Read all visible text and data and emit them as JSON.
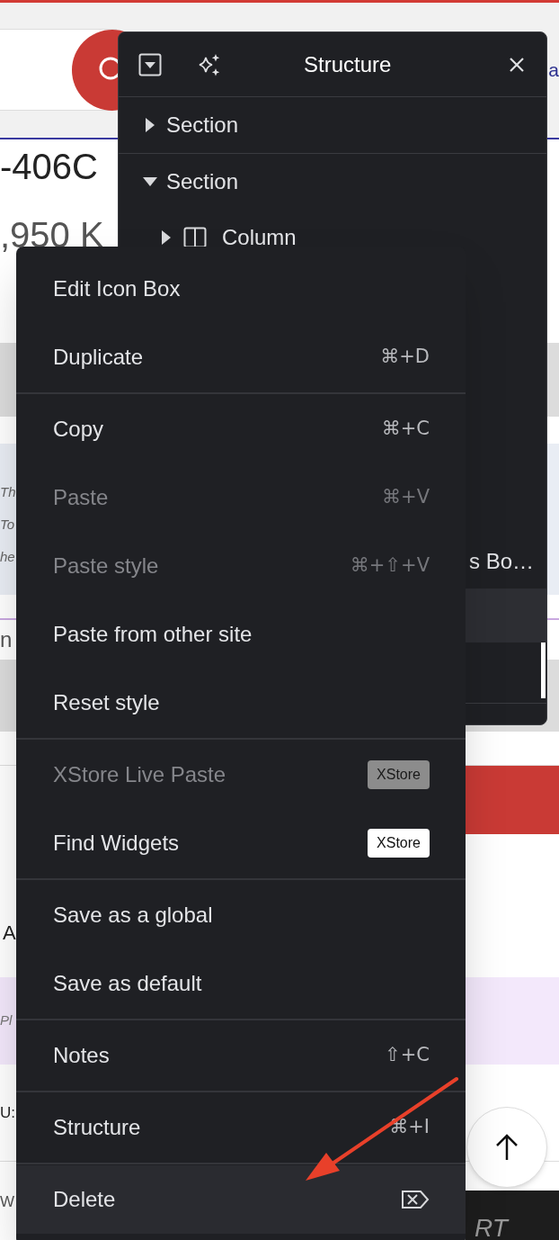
{
  "page_background": {
    "header_link": "a",
    "product_code": "-406C",
    "price": ",950 K",
    "notice_lines": [
      "Th",
      "To",
      "he"
    ],
    "tab_fragment": "n",
    "label_fragment": "A",
    "note_fragment": "Pl",
    "field_fragment": "U:",
    "total_fragment": "W",
    "button_fragment": "RT"
  },
  "structure_panel": {
    "title": "Structure",
    "tree": [
      {
        "kind": "section",
        "label": "Section",
        "expanded": false
      },
      {
        "kind": "section",
        "label": "Section",
        "expanded": true,
        "children": [
          {
            "kind": "column",
            "label": "Column",
            "expanded": false
          }
        ]
      }
    ],
    "lower_rows": [
      {
        "label": "s Bo…"
      }
    ]
  },
  "context_menu": {
    "groups": [
      [
        {
          "label": "Edit Icon Box",
          "disabled": false,
          "highlighted": false
        },
        {
          "label": "Duplicate",
          "disabled": false,
          "highlighted": false,
          "trailing": {
            "kind": "keys",
            "text": "⌘+D"
          }
        }
      ],
      [
        {
          "label": "Copy",
          "disabled": false,
          "highlighted": false,
          "trailing": {
            "kind": "keys",
            "text": "⌘+C"
          }
        },
        {
          "label": "Paste",
          "disabled": true,
          "highlighted": false,
          "trailing": {
            "kind": "keys",
            "text": "⌘+V"
          }
        },
        {
          "label": "Paste style",
          "disabled": true,
          "highlighted": false,
          "trailing": {
            "kind": "keys",
            "text": "⌘+⇧+V"
          }
        },
        {
          "label": "Paste from other site",
          "disabled": false,
          "highlighted": false
        },
        {
          "label": "Reset style",
          "disabled": false,
          "highlighted": false
        }
      ],
      [
        {
          "label": "XStore Live Paste",
          "disabled": true,
          "highlighted": false,
          "trailing": {
            "kind": "badge",
            "text": "XStore"
          }
        },
        {
          "label": "Find Widgets",
          "disabled": false,
          "highlighted": false,
          "trailing": {
            "kind": "badge",
            "text": "XStore"
          }
        }
      ],
      [
        {
          "label": "Save as a global",
          "disabled": false,
          "highlighted": false
        },
        {
          "label": "Save as default",
          "disabled": false,
          "highlighted": false
        }
      ],
      [
        {
          "label": "Notes",
          "disabled": false,
          "highlighted": false,
          "trailing": {
            "kind": "keys",
            "text": "⇧+C"
          }
        }
      ],
      [
        {
          "label": "Structure",
          "disabled": false,
          "highlighted": false,
          "trailing": {
            "kind": "keys",
            "text": "⌘+I"
          }
        }
      ],
      [
        {
          "label": "Delete",
          "disabled": false,
          "highlighted": true,
          "trailing": {
            "kind": "delete-key"
          }
        }
      ]
    ]
  }
}
